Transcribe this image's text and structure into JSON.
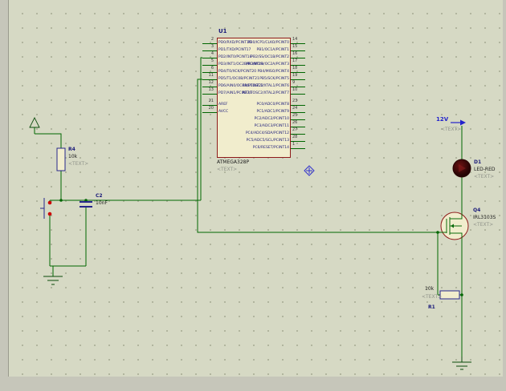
{
  "sheet": {
    "background": "#d6d9c4",
    "grid_dot": "#aeb29b",
    "margin": "#c6c6ba"
  },
  "colors": {
    "wire": "#006600",
    "device_outline": "#8e1a1a",
    "device_fill": "#f1edcd",
    "passive_outline": "#26268c",
    "terminal": "#0a4a0a",
    "power_blue": "#2222cc",
    "led_dark_red": "#3a0808",
    "placeholder_gray": "#8f9289"
  },
  "chip": {
    "ref": "U1",
    "value": "ATMEGA328P",
    "placeholder": "<TEXT>",
    "left_pins": [
      {
        "num": "2",
        "name": "PD0/RXD/PCINT16"
      },
      {
        "num": "3",
        "name": "PD1/TXD/PCINT17"
      },
      {
        "num": "4",
        "name": "PD2/INT0/PCINT18"
      },
      {
        "num": "5",
        "name": "PD3/INT1/OC2B/PCINT19"
      },
      {
        "num": "6",
        "name": "PD4/T0/XCK/PCINT20"
      },
      {
        "num": "11",
        "name": "PD5/T1/OC0B/PCINT21"
      },
      {
        "num": "12",
        "name": "PD6/AIN0/OC0A/PCINT22"
      },
      {
        "num": "13",
        "name": "PD7/AIN1/PCINT23"
      },
      {
        "num": "21",
        "name": "AREF"
      },
      {
        "num": "20",
        "name": "AVCC"
      }
    ],
    "right_pins": [
      {
        "num": "14",
        "name": "PB0/ICP1/CLKO/PCINT0"
      },
      {
        "num": "15",
        "name": "PB1/OC1A/PCINT1"
      },
      {
        "num": "16",
        "name": "PB2/SS/OC1B/PCINT2"
      },
      {
        "num": "17",
        "name": "PB3/MOSI/OC2A/PCINT3"
      },
      {
        "num": "18",
        "name": "PB4/MISO/PCINT4"
      },
      {
        "num": "19",
        "name": "PB5/SCK/PCINT5"
      },
      {
        "num": "9",
        "name": "PB6/TOSC1/XTAL1/PCINT6"
      },
      {
        "num": "10",
        "name": "PB7/TOSC2/XTAL2/PCINT7"
      },
      {
        "num": "23",
        "name": "PC0/ADC0/PCINT8"
      },
      {
        "num": "24",
        "name": "PC1/ADC1/PCINT9"
      },
      {
        "num": "25",
        "name": "PC2/ADC2/PCINT10"
      },
      {
        "num": "26",
        "name": "PC3/ADC3/PCINT11"
      },
      {
        "num": "27",
        "name": "PC4/ADC4/SDA/PCINT12"
      },
      {
        "num": "28",
        "name": "PC5/ADC5/SCL/PCINT13"
      },
      {
        "num": "1",
        "name": "PC6/RESET/PCINT14"
      }
    ]
  },
  "parts": {
    "r4": {
      "ref": "R4",
      "value": "10k",
      "placeholder": "<TEXT>"
    },
    "c2": {
      "ref": "C2",
      "value": "10nF"
    },
    "r1": {
      "ref": "R1",
      "value": "10k",
      "placeholder": "<TEXT>"
    },
    "d1": {
      "ref": "D1",
      "value": "LED-RED",
      "placeholder": "<TEXT>"
    },
    "q4": {
      "ref": "Q4",
      "value": "IRL3103S",
      "placeholder": "<TEXT>"
    },
    "vpower": {
      "label": "12V",
      "placeholder": "<TEXT>"
    }
  }
}
